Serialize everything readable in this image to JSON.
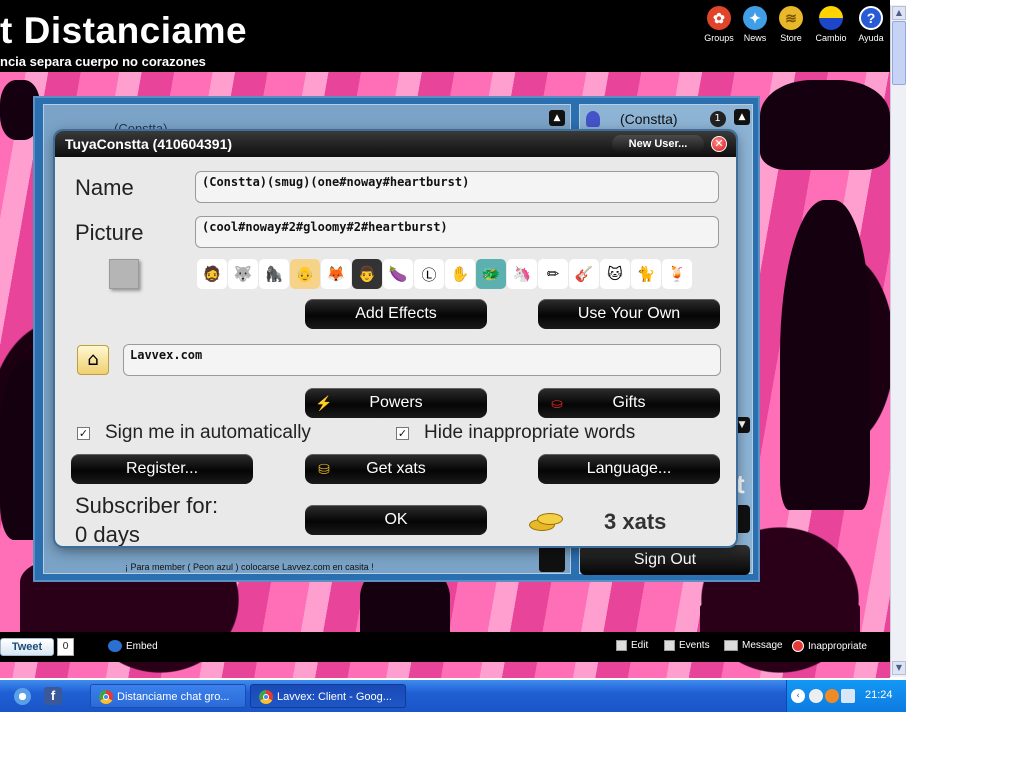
{
  "site": {
    "title": "t Distanciame",
    "subtitle": "ncia separa cuerpo no corazones"
  },
  "topnav": [
    {
      "label": "Groups",
      "icon": "groups-icon",
      "color": "#e0452c"
    },
    {
      "label": "News",
      "icon": "news-bird-icon",
      "color": "#3f9ee6"
    },
    {
      "label": "Store",
      "icon": "coins-icon",
      "color": "#e7b82a"
    },
    {
      "label": "Cambio",
      "icon": "cambio-icon",
      "color": "#1d47c8"
    },
    {
      "label": "Ayuda",
      "icon": "help-icon",
      "color": "#2a5bd6"
    }
  ],
  "chat": {
    "user_name": "(Constta)",
    "user_name_dim": "(Constta)",
    "bottom_note": "¡ Para member ( Peon azul ) colocarse Lavvez.com en casita !",
    "sign_out": "Sign Out",
    "partial_t": "t"
  },
  "dialog": {
    "title": "TuyaConstta (410604391)",
    "new_user": "New User...",
    "name_label": "Name",
    "name_value": "(Constta)(smug)(one#noway#heartburst)",
    "picture_label": "Picture",
    "picture_value": "(cool#noway#2#gloomy#2#heartburst)",
    "add_effects": "Add Effects",
    "use_your_own": "Use Your Own",
    "home_value": "Lavvex.com",
    "powers": "Powers",
    "gifts": "Gifts",
    "sign_auto": "Sign me in automatically",
    "hide_words": "Hide inappropriate words",
    "sign_auto_checked": true,
    "hide_words_checked": true,
    "register": "Register...",
    "get_xats": "Get xats",
    "language": "Language...",
    "subscriber_line1": "Subscriber for:",
    "subscriber_line2": "0 days",
    "ok": "OK",
    "xats": "3 xats"
  },
  "avatars": [
    {
      "name": "avatar-man-hat",
      "glyph": "🧔",
      "bg": "#fff"
    },
    {
      "name": "avatar-brown-dog",
      "glyph": "🐺",
      "bg": "#fff"
    },
    {
      "name": "avatar-gorilla",
      "glyph": "🦍",
      "bg": "#fff"
    },
    {
      "name": "avatar-bald-face",
      "glyph": "👴",
      "bg": "#f7d38a"
    },
    {
      "name": "avatar-fox",
      "glyph": "🦊",
      "bg": "#fff"
    },
    {
      "name": "avatar-photo-man",
      "glyph": "👨",
      "bg": "#333"
    },
    {
      "name": "avatar-eggplant",
      "glyph": "🍆",
      "bg": "#fff"
    },
    {
      "name": "avatar-l-badge",
      "glyph": "Ⓛ",
      "bg": "#fff"
    },
    {
      "name": "avatar-hand",
      "glyph": "✋",
      "bg": "#fff"
    },
    {
      "name": "avatar-teal-creature",
      "glyph": "🐲",
      "bg": "#5cb0b0"
    },
    {
      "name": "avatar-unicorn",
      "glyph": "🦄",
      "bg": "#fff"
    },
    {
      "name": "avatar-sketch",
      "glyph": "✏",
      "bg": "#fff"
    },
    {
      "name": "avatar-guitar",
      "glyph": "🎸",
      "bg": "#fff"
    },
    {
      "name": "avatar-cartoon",
      "glyph": "🐱",
      "bg": "#fff"
    },
    {
      "name": "avatar-hello-kitty",
      "glyph": "🐈",
      "bg": "#fff"
    },
    {
      "name": "avatar-drink",
      "glyph": "🍹",
      "bg": "#fff"
    }
  ],
  "footer": {
    "tweet": "Tweet",
    "tweet_count": "0",
    "embed": "Embed",
    "edit": "Edit",
    "events": "Events",
    "message": "Message",
    "inappropriate": "Inappropriate"
  },
  "taskbar": {
    "tab1": "Distanciame chat gro...",
    "tab2": "Lavvex: Client - Goog...",
    "clock": "21:24"
  },
  "colors": {
    "chat_blue": "#2a6fb0",
    "taskbar_blue": "#1f5fd4",
    "header_black": "#000000"
  }
}
